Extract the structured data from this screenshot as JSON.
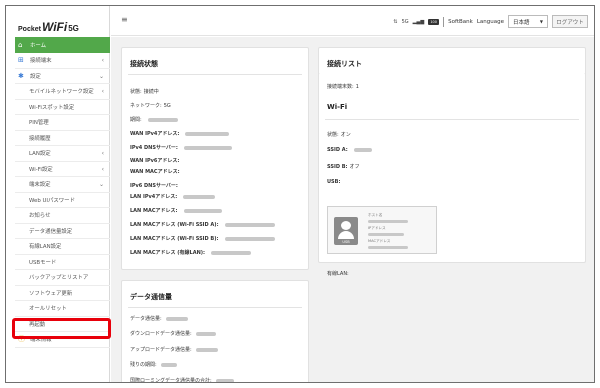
{
  "logo": {
    "part1": "Pocket",
    "part2": "WiFi",
    "part3": "5G"
  },
  "sidebar": {
    "items": [
      {
        "label": "ホーム",
        "icon": "home-icon",
        "active": true,
        "chevron": ""
      },
      {
        "label": "接続端末",
        "icon": "devices-icon",
        "active": false,
        "chevron": "‹"
      },
      {
        "label": "設定",
        "icon": "settings-icon",
        "active": false,
        "chevron": "⌄"
      },
      {
        "label": "モバイルネットワーク設定",
        "sub": true,
        "chevron": "‹"
      },
      {
        "label": "Wi-Fiスポット設定",
        "sub": true,
        "chevron": ""
      },
      {
        "label": "PIN管理",
        "sub": true,
        "chevron": ""
      },
      {
        "label": "接続履歴",
        "sub": true,
        "chevron": ""
      },
      {
        "label": "LAN設定",
        "sub": true,
        "chevron": "‹"
      },
      {
        "label": "Wi-Fi設定",
        "sub": true,
        "chevron": "‹"
      },
      {
        "label": "端末設定",
        "sub": true,
        "chevron": "⌄"
      },
      {
        "label": "Web UIパスワード",
        "sub": true,
        "chevron": ""
      },
      {
        "label": "お知らせ",
        "sub": true,
        "chevron": ""
      },
      {
        "label": "データ通信量設定",
        "sub": true,
        "chevron": ""
      },
      {
        "label": "有線LAN設定",
        "sub": true,
        "chevron": ""
      },
      {
        "label": "USBモード",
        "sub": true,
        "chevron": ""
      },
      {
        "label": "バックアップとリストア",
        "sub": true,
        "chevron": ""
      },
      {
        "label": "ソフトウェア更新",
        "sub": true,
        "chevron": ""
      },
      {
        "label": "オールリセット",
        "sub": true,
        "chevron": ""
      },
      {
        "label": "再起動",
        "sub": true,
        "chevron": ""
      },
      {
        "label": "端末情報",
        "icon": "info-icon",
        "active": false,
        "chevron": ""
      }
    ]
  },
  "header": {
    "signal_text": "5G",
    "battery_text": "100",
    "carrier": "SoftBank",
    "language_label": "Language",
    "language_value": "日本語",
    "logout_label": "ログアウト"
  },
  "status_card": {
    "title": "接続状態",
    "rows": [
      {
        "label": "状態: ",
        "value": "接続中"
      },
      {
        "label": "ネットワーク: ",
        "value": "5G"
      },
      {
        "label": "期間: ",
        "value": ""
      },
      {
        "label": "WAN IPv4アドレス: ",
        "value": ""
      },
      {
        "label": "IPv4 DNSサーバー: ",
        "value": ""
      },
      {
        "label": "WAN IPv6アドレス: ",
        "value": ""
      },
      {
        "label": "WAN MACアドレス: ",
        "value": ""
      },
      {
        "label": "IPv6 DNSサーバー: ",
        "value": ""
      },
      {
        "label": "LAN IPv4アドレス: ",
        "value": ""
      },
      {
        "label": "LAN MACアドレス: ",
        "value": ""
      },
      {
        "label": "LAN MACアドレス (Wi-Fi SSID A): ",
        "value": ""
      },
      {
        "label": "LAN MACアドレス (Wi-Fi SSID B): ",
        "value": ""
      },
      {
        "label": "LAN MACアドレス (有線LAN): ",
        "value": ""
      }
    ]
  },
  "connection_card": {
    "title": "接続リスト",
    "count_label": "接続端末数: ",
    "count_value": "1"
  },
  "wifi_card": {
    "title": "Wi-Fi",
    "rows": [
      {
        "label": "状態: ",
        "value": "オン"
      },
      {
        "label": "SSID A: ",
        "value": ""
      },
      {
        "label": "SSID B: ",
        "value": "オフ"
      },
      {
        "label": "USB: ",
        "value": ""
      }
    ],
    "usb_box": {
      "icon_label": "USB",
      "lines": [
        "ホスト名",
        "IPアドレス",
        "MACアドレス"
      ]
    },
    "wired_label": "有線LAN: "
  },
  "data_card": {
    "title": "データ通信量",
    "rows": [
      {
        "label": "データ通信量: "
      },
      {
        "label": "ダウンロードデータ通信量: "
      },
      {
        "label": "アップロードデータ通信量: "
      },
      {
        "label": "残りの期間: "
      },
      {
        "label": "国際ローミングデータ通信量の合計: "
      }
    ]
  },
  "colors": {
    "active_green": "#52a84a",
    "highlight_red": "#e8000b"
  }
}
